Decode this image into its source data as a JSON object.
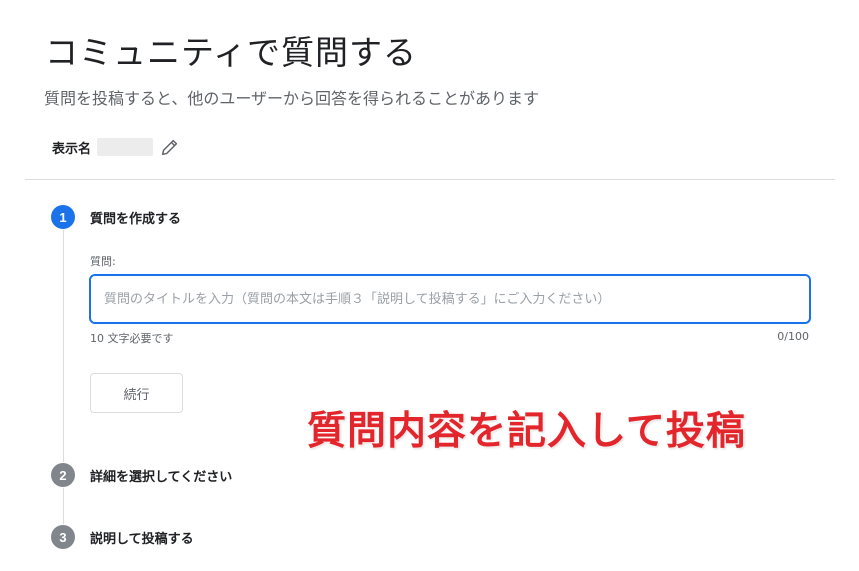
{
  "header": {
    "title": "コミュニティで質問する",
    "subtitle": "質問を投稿すると、他のユーザーから回答を得られることがあります"
  },
  "display_name": {
    "label": "表示名",
    "value": "",
    "edit_icon": "pencil-icon"
  },
  "steps": [
    {
      "number": "1",
      "label": "質問を作成する",
      "state": "active"
    },
    {
      "number": "2",
      "label": "詳細を選択してください",
      "state": "inactive"
    },
    {
      "number": "3",
      "label": "説明して投稿する",
      "state": "inactive"
    }
  ],
  "question_form": {
    "field_label": "質問:",
    "value": "",
    "placeholder": "質問のタイトルを入力（質問の本文は手順３「説明して投稿する」にご入力ください）",
    "hint": "10 文字必要です",
    "counter": "0/100",
    "continue_label": "続行"
  },
  "annotation": {
    "text": "質問内容を記入して投稿"
  },
  "colors": {
    "accent": "#1a73e8",
    "step_inactive": "#80868b",
    "annotation": "#e3262b"
  }
}
